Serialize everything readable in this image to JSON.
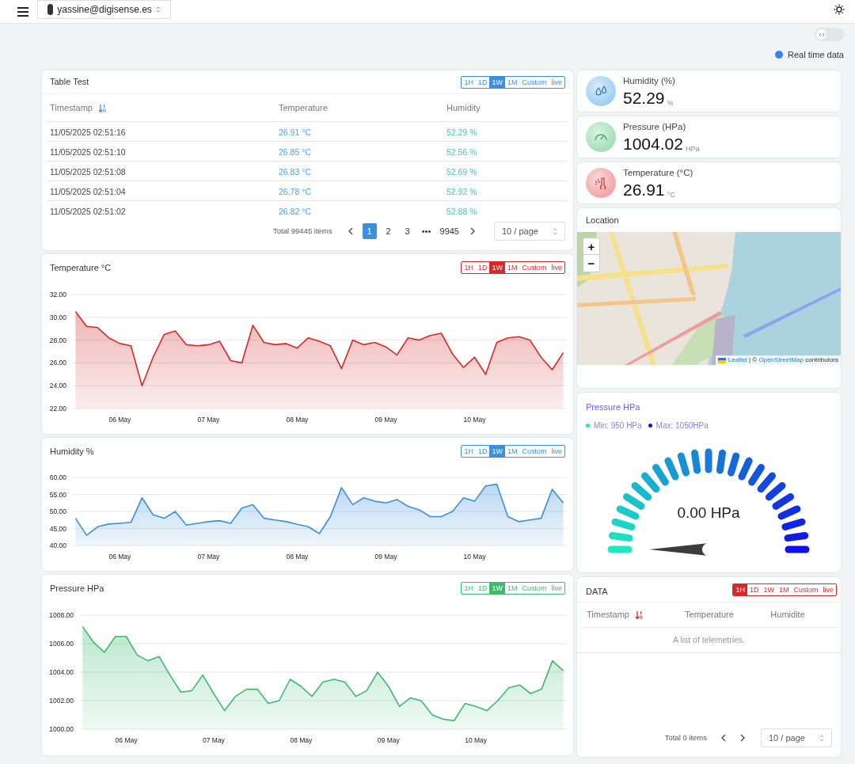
{
  "header": {
    "account": "yassine@digisense.es"
  },
  "toolbar": {
    "code_view_on": false,
    "realtime_label": "Real time data"
  },
  "table_test": {
    "title": "Table Test",
    "ranges": [
      {
        "label": "1H",
        "selected": false
      },
      {
        "label": "1D",
        "selected": false
      },
      {
        "label": "1W",
        "selected": true
      },
      {
        "label": "1M",
        "selected": false
      },
      {
        "label": "Custom",
        "selected": false
      },
      {
        "label": "live",
        "selected": false
      }
    ],
    "columns": [
      "Timestamp",
      "Temperature",
      "Humidity"
    ],
    "rows": [
      [
        "11/05/2025 02:51:16",
        "26.91 °C",
        "52.29 %"
      ],
      [
        "11/05/2025 02:51:10",
        "26.85 °C",
        "52.56 %"
      ],
      [
        "11/05/2025 02:51:08",
        "26.83 °C",
        "52.69 %"
      ],
      [
        "11/05/2025 02:51:04",
        "26.78 °C",
        "52.92 %"
      ],
      [
        "11/05/2025 02:51:02",
        "26.82 °C",
        "52.88 %"
      ]
    ],
    "pagination": {
      "total": "Total 99445 items",
      "pages": [
        {
          "label": "1",
          "selected": true
        },
        {
          "label": "2",
          "selected": false
        },
        {
          "label": "3",
          "selected": false
        },
        {
          "label": "•••",
          "selected": false
        },
        {
          "label": "9945",
          "selected": false
        }
      ],
      "page_size": "10 / page"
    }
  },
  "charts": [
    {
      "title": "Temperature °C",
      "ranges": [
        {
          "label": "1H",
          "selected": false
        },
        {
          "label": "1D",
          "selected": false
        },
        {
          "label": "1W",
          "selected": true
        },
        {
          "label": "1M",
          "selected": false
        },
        {
          "label": "Custom",
          "selected": false
        },
        {
          "label": "live",
          "selected": false
        }
      ],
      "chart_data": {
        "type": "area",
        "categories": [
          null,
          null,
          null,
          null,
          "06 May",
          null,
          null,
          null,
          null,
          null,
          null,
          null,
          "07 May",
          null,
          null,
          null,
          null,
          null,
          null,
          null,
          "08 May",
          null,
          null,
          null,
          null,
          null,
          null,
          null,
          "09 May",
          null,
          null,
          null,
          null,
          null,
          null,
          null,
          "10 May",
          null,
          null,
          null,
          null,
          null,
          null,
          null,
          null
        ],
        "series": [
          {
            "color": "#d42a2a",
            "values": [
              30.5,
              29.2,
              29.1,
              28.2,
              27.7,
              27.5,
              24.0,
              26.5,
              28.5,
              28.8,
              27.6,
              27.5,
              27.6,
              27.9,
              26.2,
              26.0,
              29.3,
              27.8,
              27.6,
              27.7,
              27.3,
              28.2,
              27.9,
              27.5,
              25.5,
              28.0,
              27.6,
              27.8,
              27.4,
              26.7,
              28.2,
              28.0,
              28.4,
              28.6,
              26.8,
              25.6,
              26.5,
              25.0,
              27.8,
              28.2,
              28.3,
              28.0,
              26.5,
              25.4,
              26.9
            ]
          }
        ],
        "ylim": [
          22,
          32
        ],
        "grid": true,
        "yticks": [
          {
            "value": 22,
            "label": "22.00"
          },
          {
            "value": 24,
            "label": "24.00"
          },
          {
            "value": 26,
            "label": "26.00"
          },
          {
            "value": 28,
            "label": "28.00"
          },
          {
            "value": 30,
            "label": "30.00"
          },
          {
            "value": 32,
            "label": "32.00"
          }
        ]
      }
    },
    {
      "title": "Humidity %",
      "ranges": [
        {
          "label": "1H",
          "selected": false
        },
        {
          "label": "1D",
          "selected": false
        },
        {
          "label": "1W",
          "selected": true
        },
        {
          "label": "1M",
          "selected": false
        },
        {
          "label": "Custom",
          "selected": false
        },
        {
          "label": "live",
          "selected": false
        }
      ],
      "chart_data": {
        "type": "area",
        "categories": [
          null,
          null,
          null,
          null,
          "06 May",
          null,
          null,
          null,
          null,
          null,
          null,
          null,
          "07 May",
          null,
          null,
          null,
          null,
          null,
          null,
          null,
          "08 May",
          null,
          null,
          null,
          null,
          null,
          null,
          null,
          "09 May",
          null,
          null,
          null,
          null,
          null,
          null,
          null,
          "10 May",
          null,
          null,
          null,
          null,
          null,
          null,
          null,
          null
        ],
        "series": [
          {
            "color": "#3b8fdc",
            "values": [
              48,
              43,
              45.5,
              46.3,
              46.5,
              46.8,
              54,
              49,
              48,
              50,
              46,
              46.5,
              47,
              47.3,
              46.5,
              51,
              52,
              48,
              47.5,
              47,
              46.2,
              45.5,
              43.5,
              48.5,
              57,
              52,
              54,
              53,
              52.5,
              53.5,
              51.5,
              50.5,
              48.5,
              48.5,
              50,
              54,
              53,
              57.5,
              58,
              48.5,
              47,
              47.5,
              48,
              56.5,
              52.5
            ]
          }
        ],
        "ylim": [
          40,
          60
        ],
        "grid": true,
        "yticks": [
          {
            "value": 40,
            "label": "40.00"
          },
          {
            "value": 45,
            "label": "45.00"
          },
          {
            "value": 50,
            "label": "50.00"
          },
          {
            "value": 55,
            "label": "55.00"
          },
          {
            "value": 60,
            "label": "60.00"
          }
        ]
      }
    },
    {
      "title": "Pressure HPa",
      "ranges": [
        {
          "label": "1H",
          "selected": false
        },
        {
          "label": "1D",
          "selected": false
        },
        {
          "label": "1W",
          "selected": true
        },
        {
          "label": "1M",
          "selected": false
        },
        {
          "label": "Custom",
          "selected": false
        },
        {
          "label": "live",
          "selected": false
        }
      ],
      "chart_data": {
        "type": "area",
        "categories": [
          null,
          null,
          null,
          null,
          "06 May",
          null,
          null,
          null,
          null,
          null,
          null,
          null,
          "07 May",
          null,
          null,
          null,
          null,
          null,
          null,
          null,
          "08 May",
          null,
          null,
          null,
          null,
          null,
          null,
          null,
          "09 May",
          null,
          null,
          null,
          null,
          null,
          null,
          null,
          "10 May",
          null,
          null,
          null,
          null,
          null,
          null,
          null,
          null
        ],
        "series": [
          {
            "color": "#3dba6f",
            "values": [
              1007.2,
              1006.1,
              1005.4,
              1006.5,
              1006.5,
              1005.2,
              1004.8,
              1005.1,
              1003.8,
              1002.6,
              1002.7,
              1003.8,
              1002.5,
              1001.3,
              1002.3,
              1002.8,
              1002.8,
              1001.8,
              1002.0,
              1003.5,
              1003.0,
              1002.3,
              1003.3,
              1003.5,
              1003.3,
              1002.3,
              1002.7,
              1004.0,
              1003.0,
              1001.6,
              1002.2,
              1002.0,
              1001.0,
              1000.7,
              1000.6,
              1001.8,
              1001.6,
              1001.3,
              1002.0,
              1002.9,
              1003.1,
              1002.5,
              1002.8,
              1004.8,
              1004.1
            ]
          }
        ],
        "ylim": [
          1000,
          1008
        ],
        "grid": true,
        "yticks": [
          {
            "value": 1000,
            "label": "1000.00"
          },
          {
            "value": 1002,
            "label": "1002.00"
          },
          {
            "value": 1004,
            "label": "1004.00"
          },
          {
            "value": 1006,
            "label": "1006.00"
          },
          {
            "value": 1008,
            "label": "1008.00"
          }
        ]
      }
    }
  ],
  "stats": [
    {
      "kind": "humidity",
      "label": "Humidity (%)",
      "value": "52.29",
      "unit": "%"
    },
    {
      "kind": "pressure",
      "label": "Pressure (HPa)",
      "value": "1004.02",
      "unit": "HPa"
    },
    {
      "kind": "temperature",
      "label": "Temperature (°C)",
      "value": "26.91",
      "unit": "°C"
    }
  ],
  "location": {
    "title": "Location",
    "zoom_in": "+",
    "zoom_out": "−",
    "attribution": [
      {
        "kind": "link",
        "text": "Leaflet"
      },
      {
        "kind": "text",
        "text": "| ©"
      },
      {
        "kind": "link",
        "text": "OpenStreetMap"
      },
      {
        "kind": "text",
        "text": "contributors"
      }
    ]
  },
  "gauge": {
    "title": "Pressure HPa",
    "legend": [
      {
        "label": "Min: 950 HPa",
        "color": "#1de9c4"
      },
      {
        "label": "Max: 1050HPa",
        "color": "#1010e8"
      }
    ],
    "reading": "0.00 HPa",
    "at_minimum": true
  },
  "data_table": {
    "title": "DATA",
    "ranges": [
      {
        "label": "1H",
        "selected": true
      },
      {
        "label": "1D",
        "selected": false
      },
      {
        "label": "1W",
        "selected": false
      },
      {
        "label": "1M",
        "selected": false
      },
      {
        "label": "Custom",
        "selected": false
      },
      {
        "label": "live",
        "selected": false
      }
    ],
    "columns": [
      "Timestamp",
      "Temperature",
      "Humidite"
    ],
    "empty_text": "A list of telemetries.",
    "pagination": {
      "total": "Total 0 items",
      "page_size": "10 / page"
    }
  }
}
